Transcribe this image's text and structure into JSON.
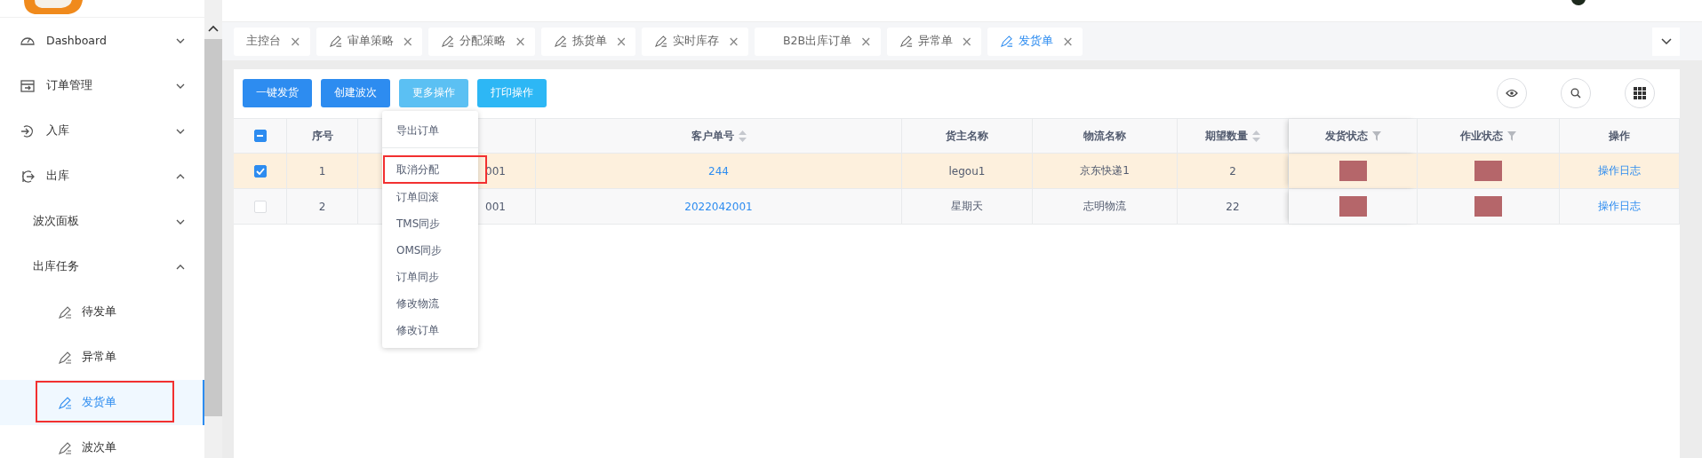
{
  "sidebar": {
    "items": [
      {
        "label": "Dashboard",
        "expanded": false
      },
      {
        "label": "订单管理",
        "expanded": false
      },
      {
        "label": "入库",
        "expanded": false
      },
      {
        "label": "出库",
        "expanded": true,
        "children": [
          {
            "label": "波次面板",
            "expanded": false
          },
          {
            "label": "出库任务",
            "expanded": true,
            "children": [
              {
                "label": "待发单",
                "selected": false,
                "highlighted": false
              },
              {
                "label": "异常单",
                "selected": false,
                "highlighted": false
              },
              {
                "label": "发货单",
                "selected": true,
                "highlighted": true
              },
              {
                "label": "波次单",
                "selected": false,
                "highlighted": false
              }
            ]
          }
        ]
      }
    ]
  },
  "tabs": [
    {
      "label": "主控台",
      "icon": false,
      "selected": false
    },
    {
      "label": "审单策略",
      "icon": true,
      "selected": false
    },
    {
      "label": "分配策略",
      "icon": true,
      "selected": false
    },
    {
      "label": "拣货单",
      "icon": true,
      "selected": false
    },
    {
      "label": "实时库存",
      "icon": true,
      "selected": false
    },
    {
      "label": "B2B出库订单",
      "icon": false,
      "selected": false
    },
    {
      "label": "异常单",
      "icon": true,
      "selected": false
    },
    {
      "label": "发货单",
      "icon": true,
      "selected": true
    }
  ],
  "tab_close": "×",
  "toolbar": {
    "buttons": [
      {
        "label": "一键发货",
        "kind": "primary"
      },
      {
        "label": "创建波次",
        "kind": "primary"
      },
      {
        "label": "更多操作",
        "kind": "light"
      },
      {
        "label": "打印操作",
        "kind": "info"
      }
    ]
  },
  "dropdown": {
    "items": [
      {
        "label": "导出订单",
        "divider_after": true,
        "highlighted": false
      },
      {
        "label": "取消分配",
        "divider_after": false,
        "highlighted": true
      },
      {
        "label": "订单回滚",
        "divider_after": false,
        "highlighted": false
      },
      {
        "label": "TMS同步",
        "divider_after": false,
        "highlighted": false
      },
      {
        "label": "OMS同步",
        "divider_after": false,
        "highlighted": false
      },
      {
        "label": "订单同步",
        "divider_after": false,
        "highlighted": false
      },
      {
        "label": "修改物流",
        "divider_after": false,
        "highlighted": false
      },
      {
        "label": "修改订单",
        "divider_after": false,
        "highlighted": false
      }
    ]
  },
  "table": {
    "select_all": {
      "indeterminate": true
    },
    "columns": [
      {
        "label": "序号",
        "kind": "plain"
      },
      {
        "kind": "hidden"
      },
      {
        "label": "客户单号",
        "kind": "sort"
      },
      {
        "label": "货主名称",
        "kind": "plain"
      },
      {
        "label": "物流名称",
        "kind": "plain"
      },
      {
        "label": "期望数量",
        "kind": "sort"
      },
      {
        "label": "发货状态",
        "kind": "filter"
      },
      {
        "label": "作业状态",
        "kind": "filter"
      },
      {
        "label": "操作",
        "kind": "plain"
      }
    ],
    "rows": [
      {
        "selected": true,
        "index": "1",
        "column_3": "001",
        "customer_no": "244",
        "owner": "legou1",
        "carrier": "京东快递1",
        "qty": "2",
        "action": "操作日志"
      },
      {
        "selected": false,
        "index": "2",
        "column_3": "001",
        "customer_no": "2022042001",
        "owner": "星期天",
        "carrier": "志明物流",
        "qty": "22",
        "action": "操作日志"
      }
    ]
  }
}
